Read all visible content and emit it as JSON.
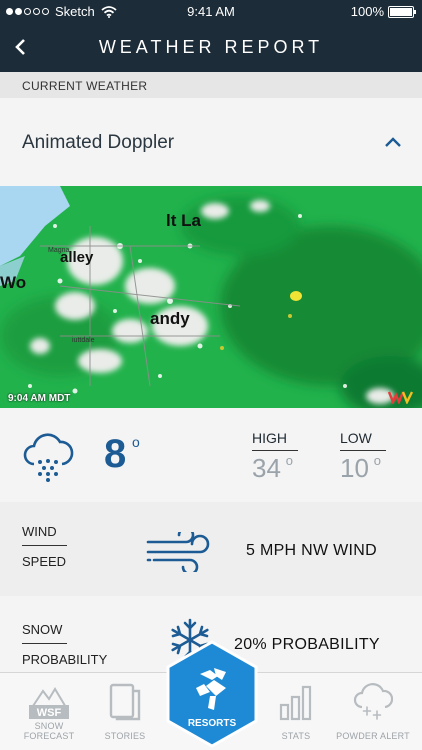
{
  "status_bar": {
    "carrier": "Sketch",
    "time": "9:41 AM",
    "battery": "100%",
    "signal_bars_filled": 2
  },
  "header": {
    "title": "WEATHER REPORT",
    "back_icon": "chevron-left-icon"
  },
  "section": {
    "label": "CURRENT WEATHER"
  },
  "doppler": {
    "title": "Animated Doppler",
    "toggle_icon": "chevron-up-icon",
    "timestamp": "9:04 AM MDT"
  },
  "temperature": {
    "icon": "snow-cloud-icon",
    "current": "8",
    "degree": "o",
    "high_label": "HIGH",
    "high": "34",
    "low_label": "LOW",
    "low": "10"
  },
  "wind": {
    "label_top": "WIND",
    "label_bottom": "SPEED",
    "icon": "wind-icon",
    "value": "5 MPH NW WIND"
  },
  "snow": {
    "label_top": "SNOW",
    "label_bottom": "PROBABILITY",
    "icon": "snowflake-icon",
    "value": "20% PROBABILITY"
  },
  "tabs": [
    {
      "label": "SNOW FORECAST",
      "icon": "wsf-icon",
      "badge": "WSF"
    },
    {
      "label": "STORIES",
      "icon": "stories-icon"
    },
    {
      "label": "RESORTS",
      "icon": "resorts-icon",
      "active": true
    },
    {
      "label": "STATS",
      "icon": "stats-icon"
    },
    {
      "label": "POWDER ALERT",
      "icon": "powder-alert-icon"
    }
  ],
  "colors": {
    "header_bg": "#1c2c38",
    "accent_blue": "#1c5b94",
    "resorts_active": "#1e8ad6",
    "radar_green": "#1db44b"
  }
}
